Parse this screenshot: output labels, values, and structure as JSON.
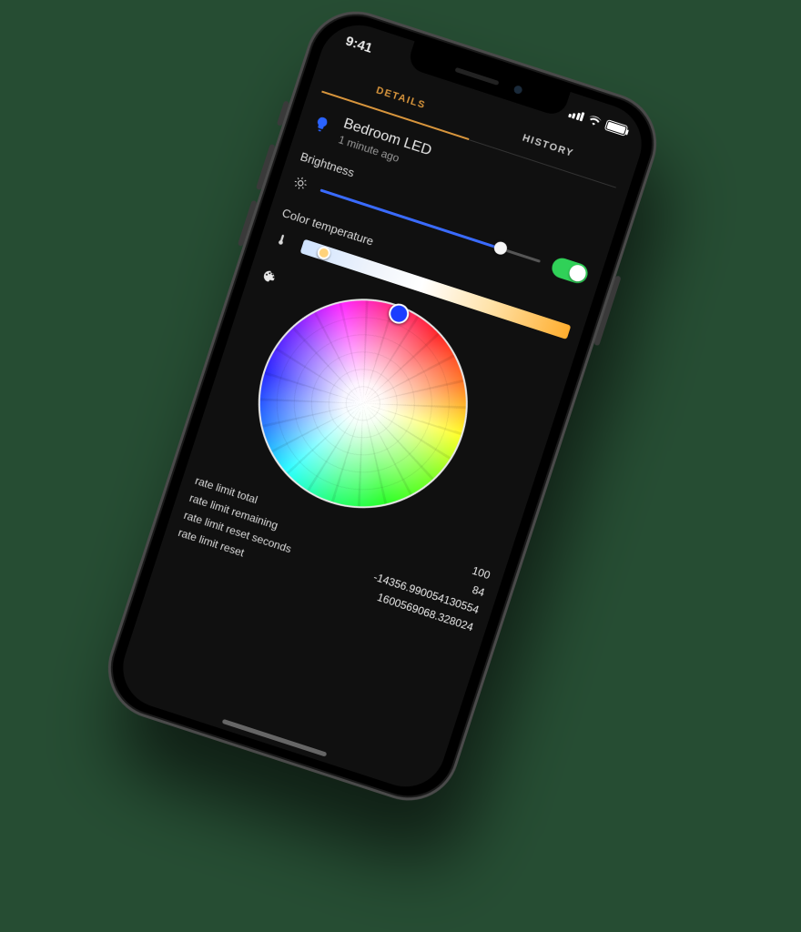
{
  "statusbar": {
    "time": "9:41"
  },
  "tabs": {
    "details": "Details",
    "history": "History"
  },
  "device": {
    "name": "Bedroom LED",
    "updated": "1 minute ago"
  },
  "brightness": {
    "label": "Brightness",
    "fill_pct": 82,
    "thumb_pct": 82,
    "toggle_on": true
  },
  "color_temp": {
    "label": "Color temperature",
    "thumb_pct": 8
  },
  "icons": {
    "bulb": "bulb-icon",
    "brightness": "sun-icon",
    "temp": "thermometer-icon",
    "color": "palette-icon"
  },
  "attrs": [
    {
      "k": "rate limit total",
      "v": "100"
    },
    {
      "k": "rate limit remaining",
      "v": "84"
    },
    {
      "k": "rate limit reset seconds",
      "v": "-14356.990054130554"
    },
    {
      "k": "rate limit reset",
      "v": "1600569068.328024"
    }
  ]
}
